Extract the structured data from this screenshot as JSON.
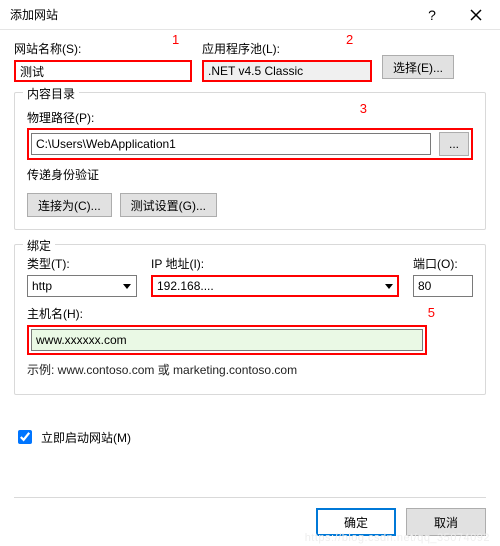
{
  "titlebar": {
    "title": "添加网站"
  },
  "annotations": {
    "a1": "1",
    "a2": "2",
    "a3": "3",
    "a5": "5"
  },
  "siteName": {
    "label": "网站名称(S):",
    "value": "测试"
  },
  "appPool": {
    "label": "应用程序池(L):",
    "value": ".NET v4.5 Classic",
    "selectBtn": "选择(E)..."
  },
  "content": {
    "legend": "内容目录",
    "pathLabel": "物理路径(P):",
    "pathValue": "C:\\Users\\WebApplication1",
    "browseBtn": "...",
    "passThroughLabel": "传递身份验证",
    "connectAs": "连接为(C)...",
    "testSettings": "测试设置(G)..."
  },
  "binding": {
    "legend": "绑定",
    "typeLabel": "类型(T):",
    "typeValue": "http",
    "ipLabel": "IP 地址(I):",
    "ipValue": "192.168....",
    "portLabel": "端口(O):",
    "portValue": "80",
    "hostLabel": "主机名(H):",
    "hostValue": "www.xxxxxx.com",
    "example": "示例: www.contoso.com 或 marketing.contoso.com"
  },
  "startImmediately": {
    "label": "立即启动网站(M)",
    "checked": true
  },
  "buttons": {
    "ok": "确定",
    "cancel": "取消"
  }
}
